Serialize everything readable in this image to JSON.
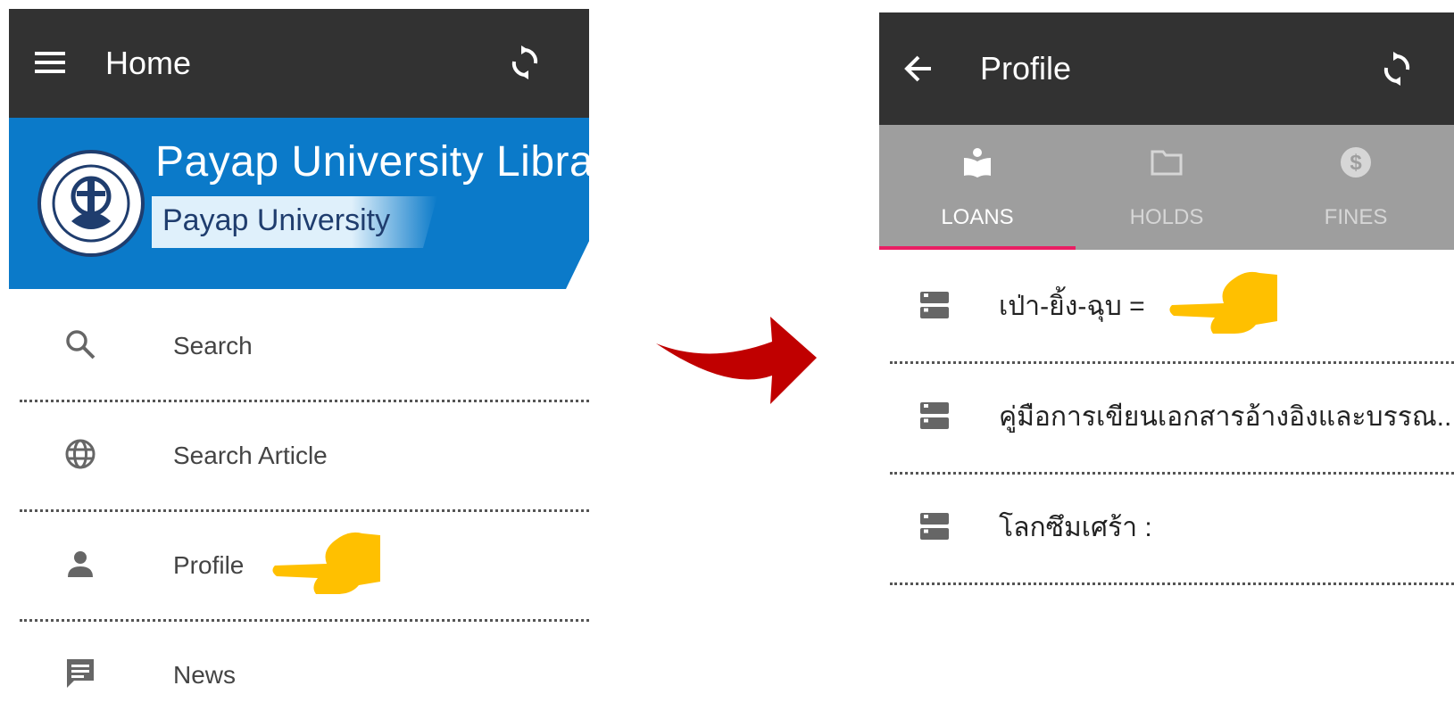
{
  "left_screen": {
    "appbar": {
      "title": "Home"
    },
    "banner": {
      "title": "Payap University Library",
      "subtitle": "Payap University"
    },
    "menu": [
      {
        "label": "Search",
        "icon": "search-icon"
      },
      {
        "label": "Search Article",
        "icon": "globe-icon"
      },
      {
        "label": "Profile",
        "icon": "person-icon"
      },
      {
        "label": "News",
        "icon": "message-icon"
      }
    ]
  },
  "right_screen": {
    "appbar": {
      "title": "Profile"
    },
    "tabs": [
      {
        "label": "LOANS",
        "icon": "book-reader-icon",
        "active": true
      },
      {
        "label": "HOLDS",
        "icon": "folder-icon",
        "active": false
      },
      {
        "label": "FINES",
        "icon": "dollar-circle-icon",
        "active": false
      }
    ],
    "loans": [
      {
        "title": "เป่า-ยิ้ง-ฉุบ ="
      },
      {
        "title": "คู่มือการเขียนเอกสารอ้างอิงและบรรณ..."
      },
      {
        "title": "โลกซึมเศร้า :"
      }
    ]
  },
  "colors": {
    "appbar": "#323232",
    "banner_blue": "#0b7ac9",
    "tab_bar": "#9e9e9e",
    "tab_indicator": "#e91e63",
    "pointer_hand": "#ffc000",
    "transition_arrow": "#c00000"
  }
}
